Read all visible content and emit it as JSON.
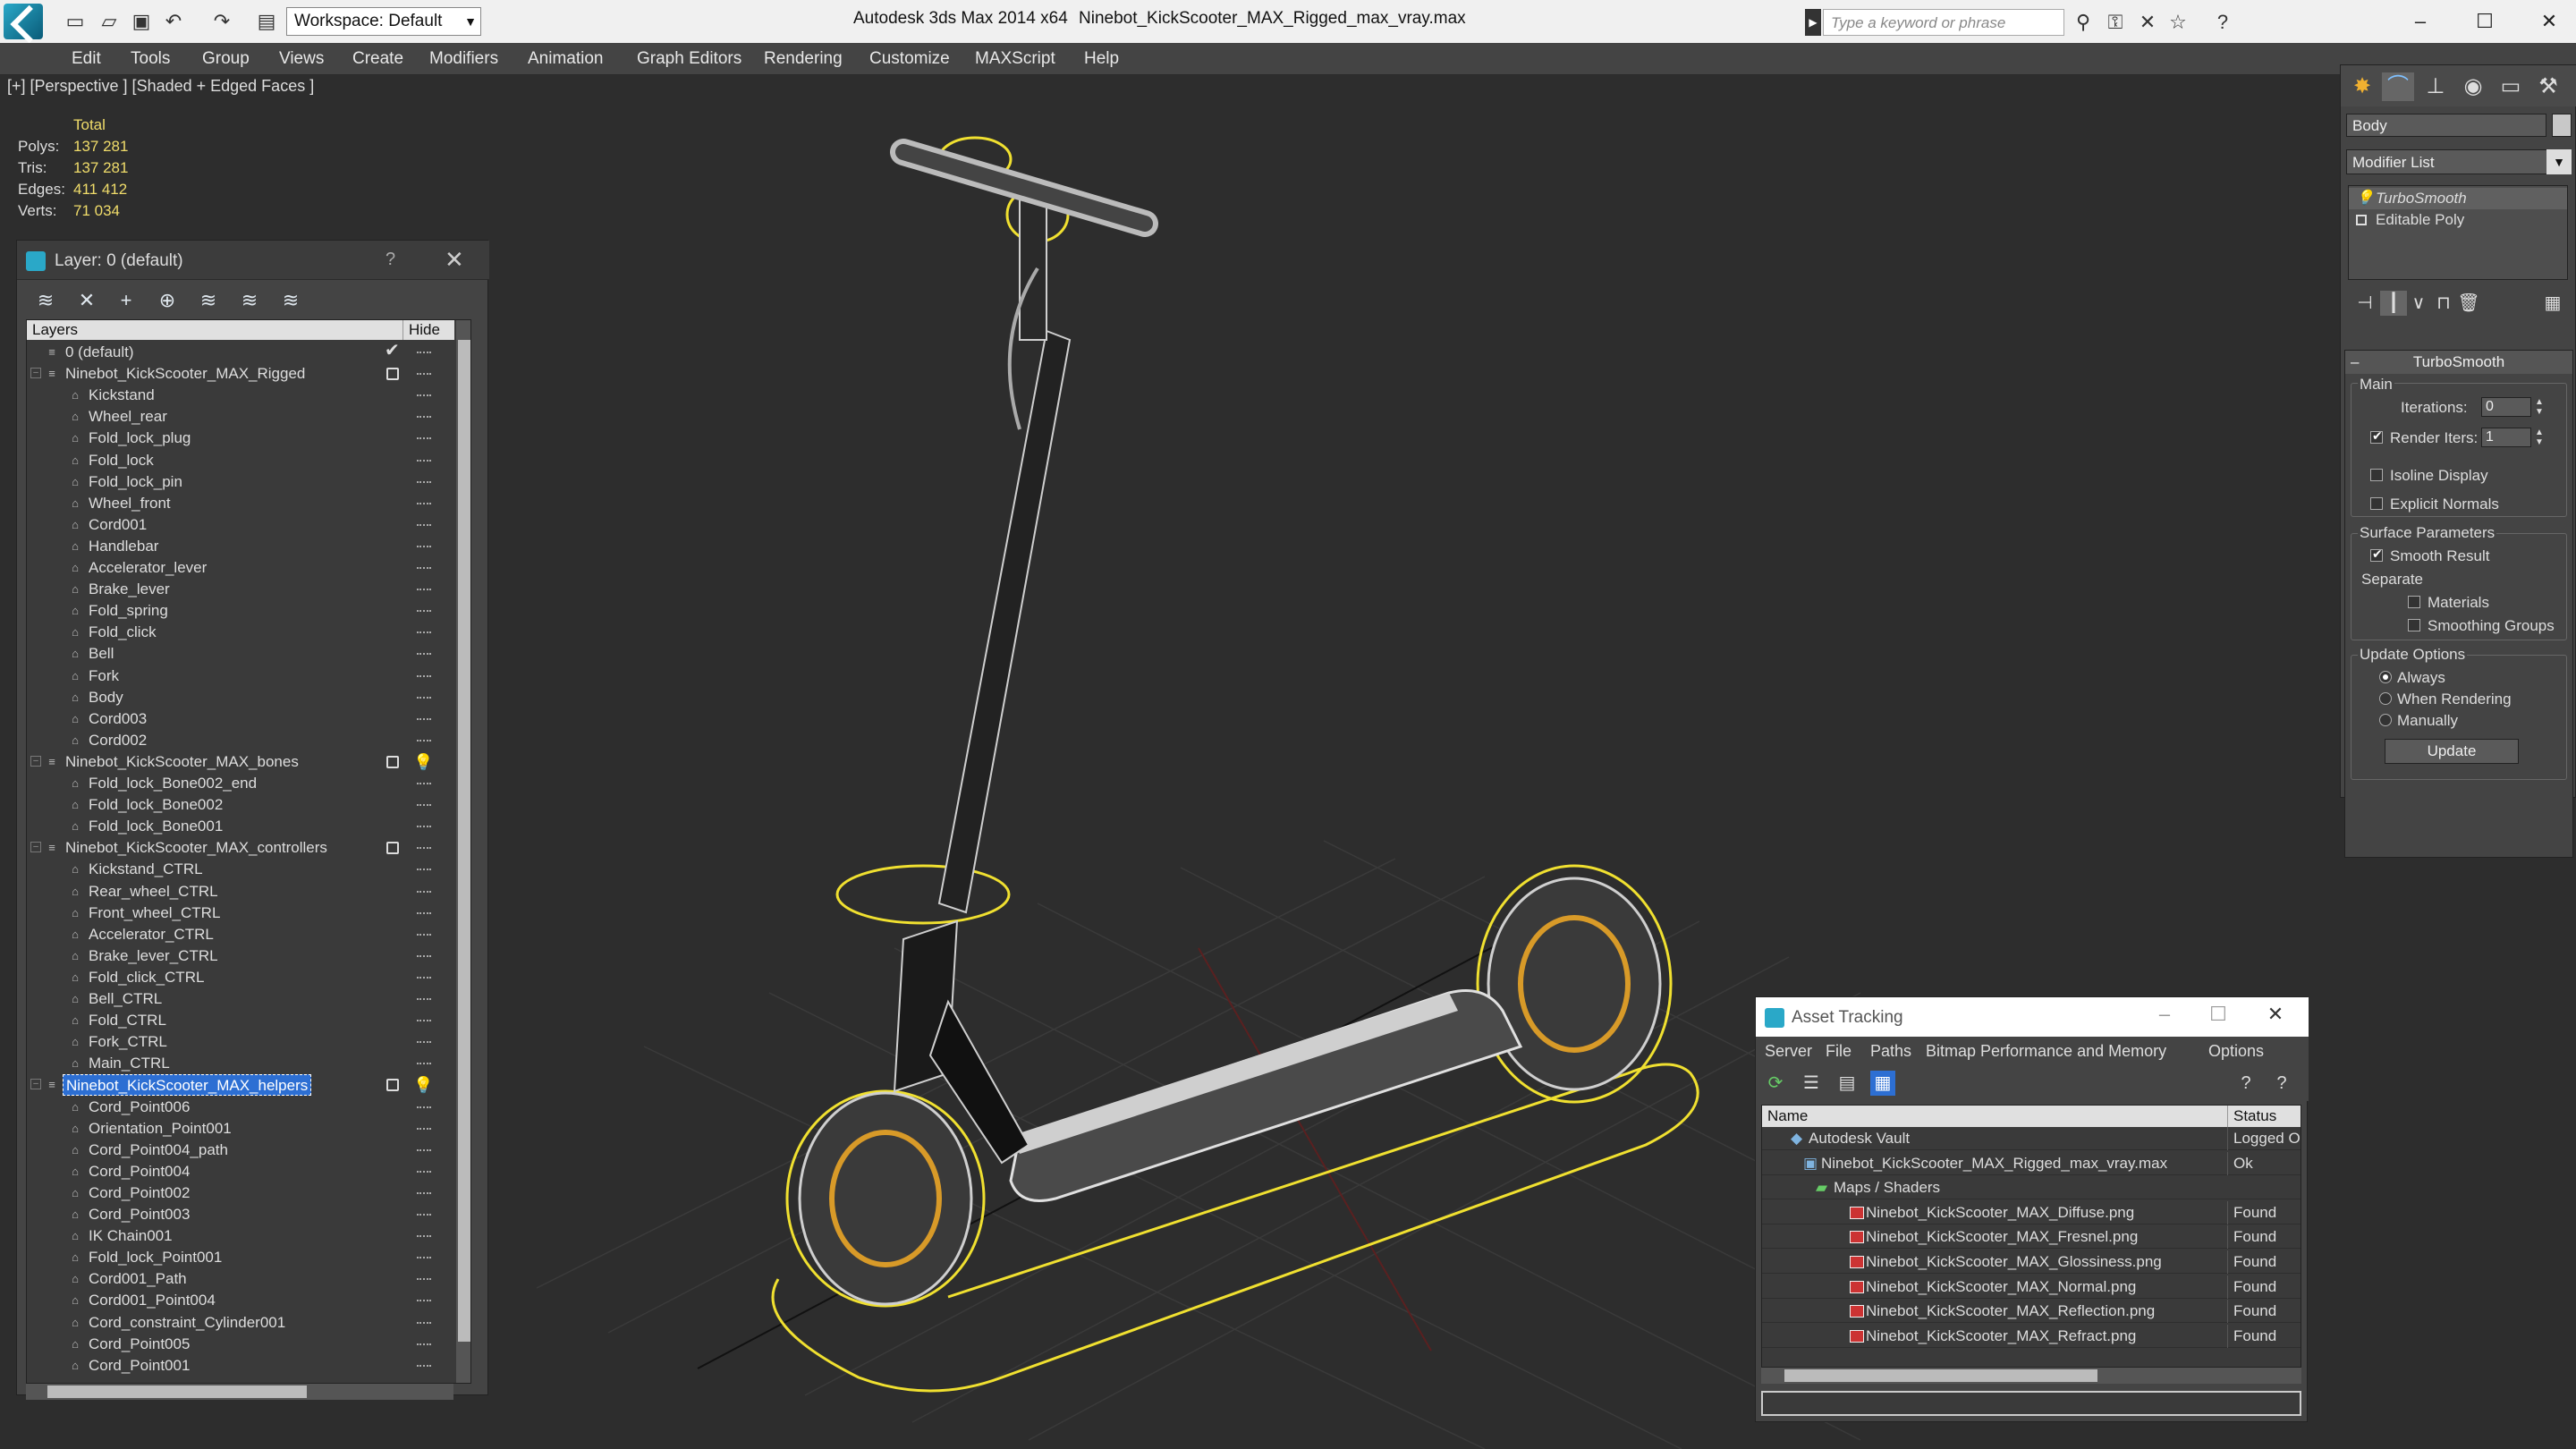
{
  "app": {
    "title": "Autodesk 3ds Max  2014 x64",
    "document": "Ninebot_KickScooter_MAX_Rigged_max_vray.max",
    "workspace": "Workspace: Default",
    "search_placeholder": "Type a keyword or phrase"
  },
  "menu": [
    "Edit",
    "Tools",
    "Group",
    "Views",
    "Create",
    "Modifiers",
    "Animation",
    "Graph Editors",
    "Rendering",
    "Customize",
    "MAXScript",
    "Help"
  ],
  "viewport": {
    "label": "[+] [Perspective ] [Shaded + Edged Faces ]",
    "stats": {
      "header": "Total",
      "rows": [
        {
          "label": "Polys:",
          "value": "137 281"
        },
        {
          "label": "Tris:",
          "value": "137 281"
        },
        {
          "label": "Edges:",
          "value": "411 412"
        },
        {
          "label": "Verts:",
          "value": "71 034"
        }
      ]
    }
  },
  "layer_panel": {
    "title": "Layer: 0 (default)",
    "help": "?",
    "col_layers": "Layers",
    "col_hide": "Hide",
    "rows": [
      {
        "name": "0 (default)",
        "level": 0,
        "kind": "layer",
        "current": true
      },
      {
        "name": "Ninebot_KickScooter_MAX_Rigged",
        "level": 0,
        "kind": "layer",
        "hidebox": true
      },
      {
        "name": "Kickstand",
        "level": 1,
        "kind": "obj"
      },
      {
        "name": "Wheel_rear",
        "level": 1,
        "kind": "obj"
      },
      {
        "name": "Fold_lock_plug",
        "level": 1,
        "kind": "obj"
      },
      {
        "name": "Fold_lock",
        "level": 1,
        "kind": "obj"
      },
      {
        "name": "Fold_lock_pin",
        "level": 1,
        "kind": "obj"
      },
      {
        "name": "Wheel_front",
        "level": 1,
        "kind": "obj"
      },
      {
        "name": "Cord001",
        "level": 1,
        "kind": "obj"
      },
      {
        "name": "Handlebar",
        "level": 1,
        "kind": "obj"
      },
      {
        "name": "Accelerator_lever",
        "level": 1,
        "kind": "obj"
      },
      {
        "name": "Brake_lever",
        "level": 1,
        "kind": "obj"
      },
      {
        "name": "Fold_spring",
        "level": 1,
        "kind": "obj"
      },
      {
        "name": "Fold_click",
        "level": 1,
        "kind": "obj"
      },
      {
        "name": "Bell",
        "level": 1,
        "kind": "obj"
      },
      {
        "name": "Fork",
        "level": 1,
        "kind": "obj"
      },
      {
        "name": "Body",
        "level": 1,
        "kind": "obj"
      },
      {
        "name": "Cord003",
        "level": 1,
        "kind": "obj"
      },
      {
        "name": "Cord002",
        "level": 1,
        "kind": "obj"
      },
      {
        "name": "Ninebot_KickScooter_MAX_bones",
        "level": 0,
        "kind": "layer",
        "hidebox": true,
        "bulb": true
      },
      {
        "name": "Fold_lock_Bone002_end",
        "level": 1,
        "kind": "obj"
      },
      {
        "name": "Fold_lock_Bone002",
        "level": 1,
        "kind": "obj"
      },
      {
        "name": "Fold_lock_Bone001",
        "level": 1,
        "kind": "obj"
      },
      {
        "name": "Ninebot_KickScooter_MAX_controllers",
        "level": 0,
        "kind": "layer",
        "hidebox": true
      },
      {
        "name": "Kickstand_CTRL",
        "level": 1,
        "kind": "obj"
      },
      {
        "name": "Rear_wheel_CTRL",
        "level": 1,
        "kind": "obj"
      },
      {
        "name": "Front_wheel_CTRL",
        "level": 1,
        "kind": "obj"
      },
      {
        "name": "Accelerator_CTRL",
        "level": 1,
        "kind": "obj"
      },
      {
        "name": "Brake_lever_CTRL",
        "level": 1,
        "kind": "obj"
      },
      {
        "name": "Fold_click_CTRL",
        "level": 1,
        "kind": "obj"
      },
      {
        "name": "Bell_CTRL",
        "level": 1,
        "kind": "obj"
      },
      {
        "name": "Fold_CTRL",
        "level": 1,
        "kind": "obj"
      },
      {
        "name": "Fork_CTRL",
        "level": 1,
        "kind": "obj"
      },
      {
        "name": "Main_CTRL",
        "level": 1,
        "kind": "obj"
      },
      {
        "name": "Ninebot_KickScooter_MAX_helpers",
        "level": 0,
        "kind": "layer",
        "hidebox": true,
        "bulb": true,
        "selected": true
      },
      {
        "name": "Cord_Point006",
        "level": 1,
        "kind": "obj"
      },
      {
        "name": "Orientation_Point001",
        "level": 1,
        "kind": "obj"
      },
      {
        "name": "Cord_Point004_path",
        "level": 1,
        "kind": "obj"
      },
      {
        "name": "Cord_Point004",
        "level": 1,
        "kind": "obj"
      },
      {
        "name": "Cord_Point002",
        "level": 1,
        "kind": "obj"
      },
      {
        "name": "Cord_Point003",
        "level": 1,
        "kind": "obj"
      },
      {
        "name": "IK Chain001",
        "level": 1,
        "kind": "obj"
      },
      {
        "name": "Fold_lock_Point001",
        "level": 1,
        "kind": "obj"
      },
      {
        "name": "Cord001_Path",
        "level": 1,
        "kind": "obj"
      },
      {
        "name": "Cord001_Point004",
        "level": 1,
        "kind": "obj"
      },
      {
        "name": "Cord_constraint_Cylinder001",
        "level": 1,
        "kind": "obj"
      },
      {
        "name": "Cord_Point005",
        "level": 1,
        "kind": "obj"
      },
      {
        "name": "Cord_Point001",
        "level": 1,
        "kind": "obj"
      }
    ]
  },
  "command_panel": {
    "object_name": "Body",
    "modifier_list": "Modifier List",
    "stack": [
      "TurboSmooth",
      "Editable Poly"
    ],
    "rollout_title": "TurboSmooth",
    "main_label": "Main",
    "iterations_label": "Iterations:",
    "iterations_value": "0",
    "render_iters_label": "Render Iters:",
    "render_iters_value": "1",
    "isoline": "Isoline Display",
    "explicit": "Explicit Normals",
    "surface_label": "Surface Parameters",
    "smooth_result": "Smooth Result",
    "separate": "Separate",
    "materials": "Materials",
    "smoothing_groups": "Smoothing Groups",
    "update_options": "Update Options",
    "always": "Always",
    "when_rendering": "When Rendering",
    "manually": "Manually",
    "update_btn": "Update"
  },
  "asset_tracking": {
    "title": "Asset Tracking",
    "menu": [
      "Server",
      "File",
      "Paths",
      "Bitmap Performance and Memory",
      "Options"
    ],
    "col_name": "Name",
    "col_status": "Status",
    "rows": [
      {
        "name": "Autodesk Vault",
        "status": "Logged Out",
        "indent": 0,
        "icon": "vault"
      },
      {
        "name": "Ninebot_KickScooter_MAX_Rigged_max_vray.max",
        "status": "Ok",
        "indent": 1,
        "icon": "max"
      },
      {
        "name": "Maps / Shaders",
        "status": "",
        "indent": 2,
        "icon": "folder"
      },
      {
        "name": "Ninebot_KickScooter_MAX_Diffuse.png",
        "status": "Found",
        "indent": 3,
        "icon": "png"
      },
      {
        "name": "Ninebot_KickScooter_MAX_Fresnel.png",
        "status": "Found",
        "indent": 3,
        "icon": "png"
      },
      {
        "name": "Ninebot_KickScooter_MAX_Glossiness.png",
        "status": "Found",
        "indent": 3,
        "icon": "png"
      },
      {
        "name": "Ninebot_KickScooter_MAX_Normal.png",
        "status": "Found",
        "indent": 3,
        "icon": "png"
      },
      {
        "name": "Ninebot_KickScooter_MAX_Reflection.png",
        "status": "Found",
        "indent": 3,
        "icon": "png"
      },
      {
        "name": "Ninebot_KickScooter_MAX_Refract.png",
        "status": "Found",
        "indent": 3,
        "icon": "png"
      }
    ]
  }
}
